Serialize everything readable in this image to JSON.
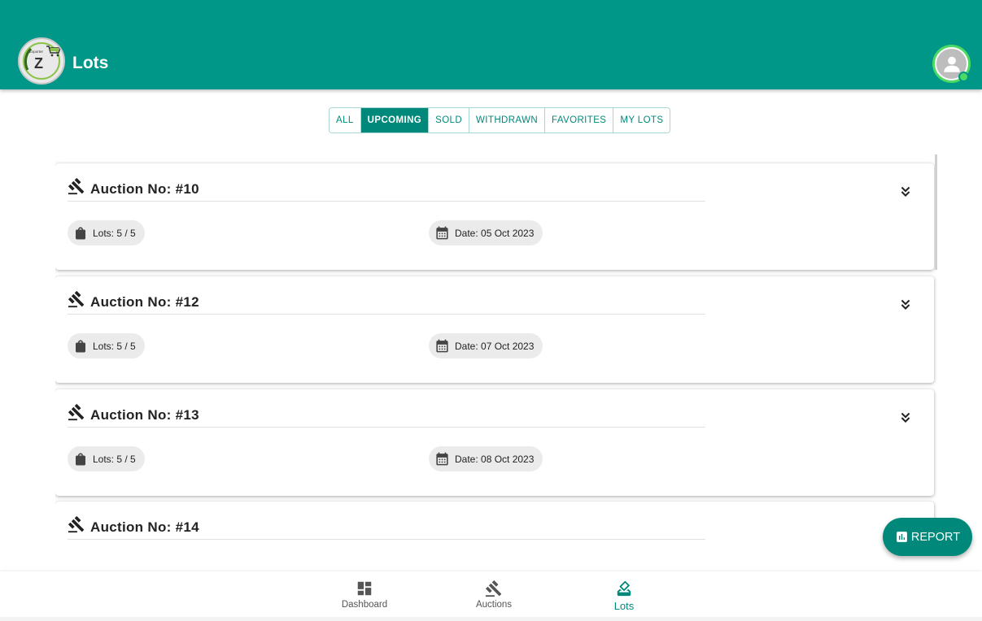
{
  "header": {
    "title": "Lots",
    "logo_text": "Z",
    "logo_caption": "Exporter",
    "logo_icon": "cart-icon",
    "avatar_icon": "person-icon"
  },
  "tabs": [
    {
      "label": "ALL",
      "active": false
    },
    {
      "label": "UPCOMING",
      "active": true
    },
    {
      "label": "SOLD",
      "active": false
    },
    {
      "label": "WITHDRAWN",
      "active": false
    },
    {
      "label": "FAVORITES",
      "active": false
    },
    {
      "label": "MY LOTS",
      "active": false
    }
  ],
  "auctions": [
    {
      "title": "Auction No: #10",
      "lots": "Lots: 5 / 5",
      "date": "Date: 05 Oct 2023"
    },
    {
      "title": "Auction No: #12",
      "lots": "Lots: 5 / 5",
      "date": "Date: 07 Oct 2023"
    },
    {
      "title": "Auction No: #13",
      "lots": "Lots: 5 / 5",
      "date": "Date: 08 Oct 2023"
    },
    {
      "title": "Auction No: #14"
    }
  ],
  "report_button": {
    "label": "REPORT",
    "icon": "bar-chart-icon"
  },
  "bottom_nav": [
    {
      "label": "Dashboard",
      "icon": "dashboard-icon",
      "active": false
    },
    {
      "label": "Auctions",
      "icon": "gavel-icon",
      "active": false
    },
    {
      "label": "Lots",
      "icon": "lots-icon",
      "active": true
    }
  ],
  "colors": {
    "primary": "#009688",
    "accent": "#00897b",
    "online": "#4cd964"
  }
}
